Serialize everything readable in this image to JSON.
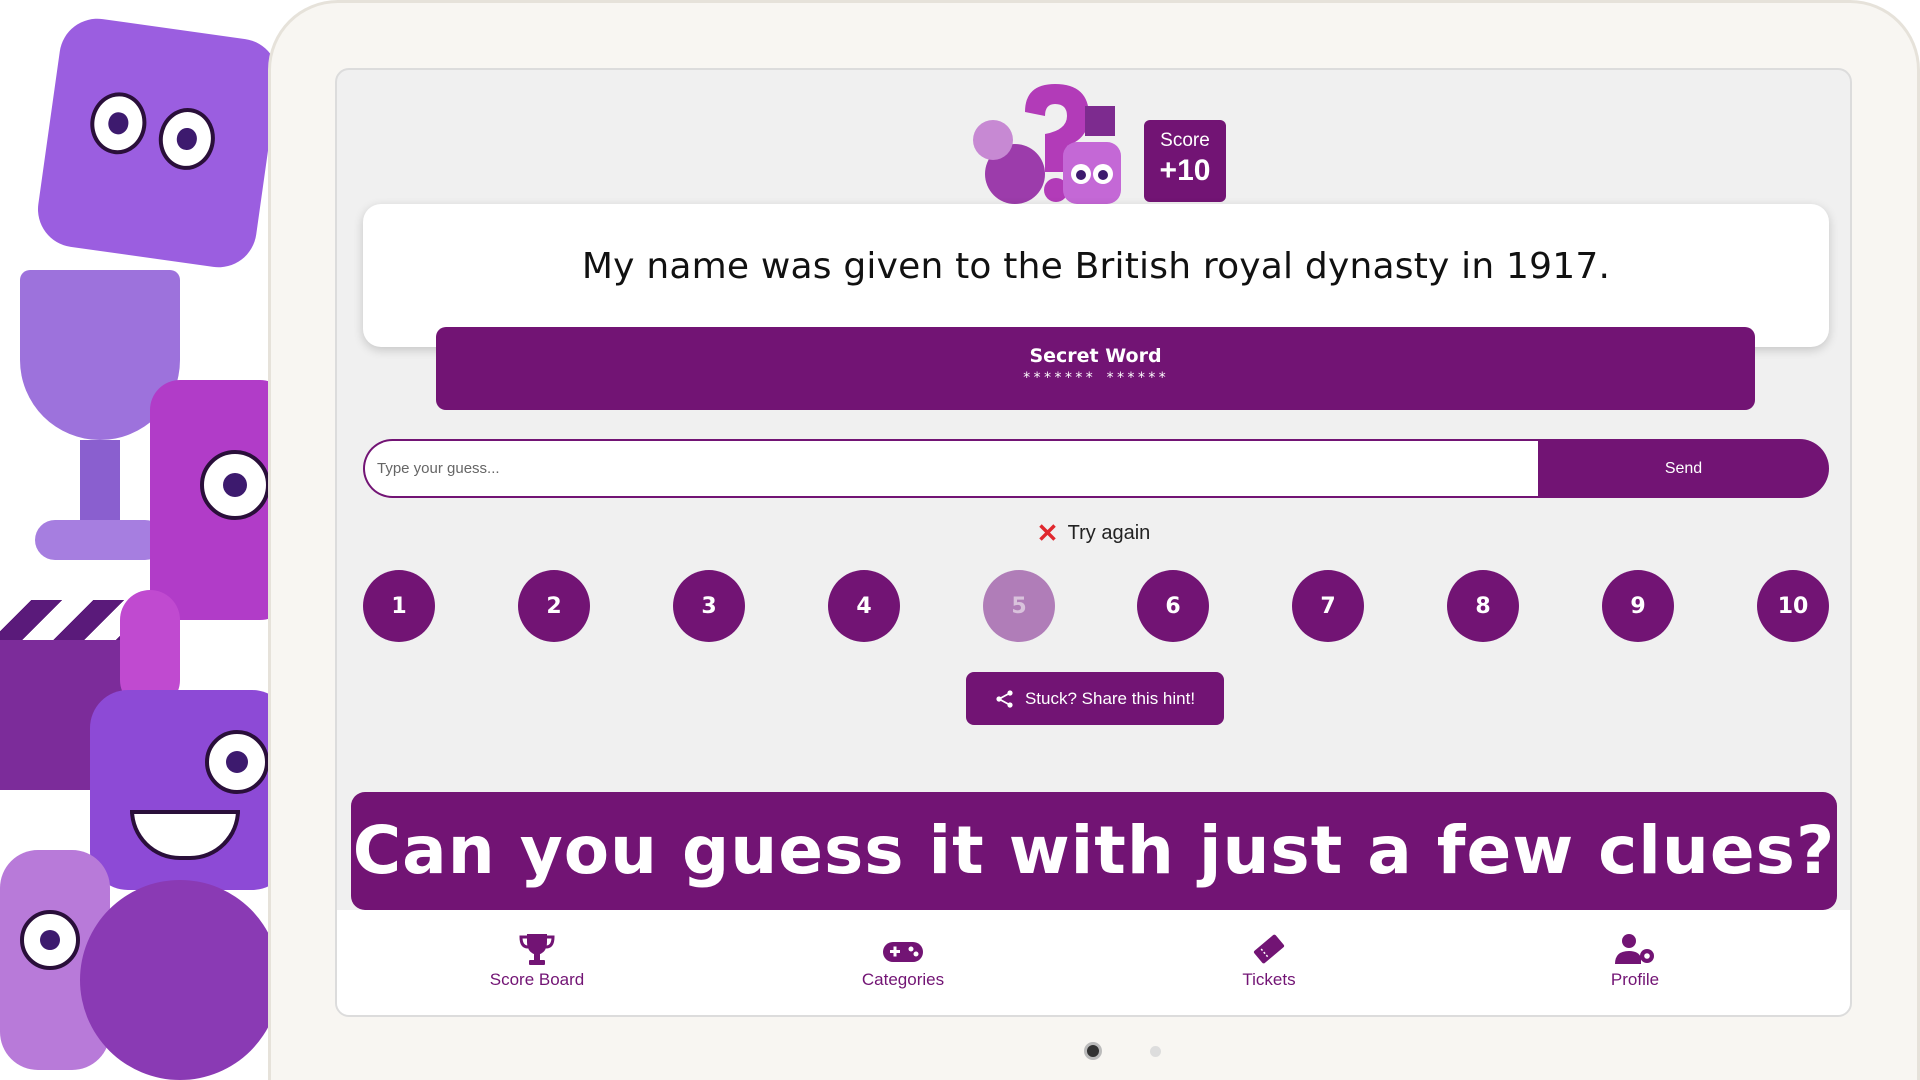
{
  "score": {
    "label": "Score",
    "value": "+10"
  },
  "clue": {
    "text": "My name was given to the British royal dynasty in 1917."
  },
  "secret_word": {
    "title": "Secret Word",
    "mask": "******* ******"
  },
  "guess": {
    "placeholder": "Type your guess...",
    "send_label": "Send"
  },
  "status": {
    "icon": "cross-mark-icon",
    "text": "Try again"
  },
  "hints": [
    {
      "label": "1"
    },
    {
      "label": "2"
    },
    {
      "label": "3"
    },
    {
      "label": "4"
    },
    {
      "label": "5",
      "active": true
    },
    {
      "label": "6"
    },
    {
      "label": "7"
    },
    {
      "label": "8"
    },
    {
      "label": "9"
    },
    {
      "label": "10"
    }
  ],
  "share": {
    "label": "Stuck? Share this hint!",
    "icon": "share-icon"
  },
  "banner": {
    "text": "Can you guess it with just a few clues?"
  },
  "nav": {
    "items": [
      {
        "label": "Score Board",
        "icon": "trophy-icon"
      },
      {
        "label": "Categories",
        "icon": "gamepad-icon"
      },
      {
        "label": "Tickets",
        "icon": "ticket-icon"
      },
      {
        "label": "Profile",
        "icon": "user-gear-icon"
      }
    ]
  },
  "colors": {
    "accent": "#721474",
    "accent_light": "#b07db8",
    "background": "#f0f0f0"
  }
}
